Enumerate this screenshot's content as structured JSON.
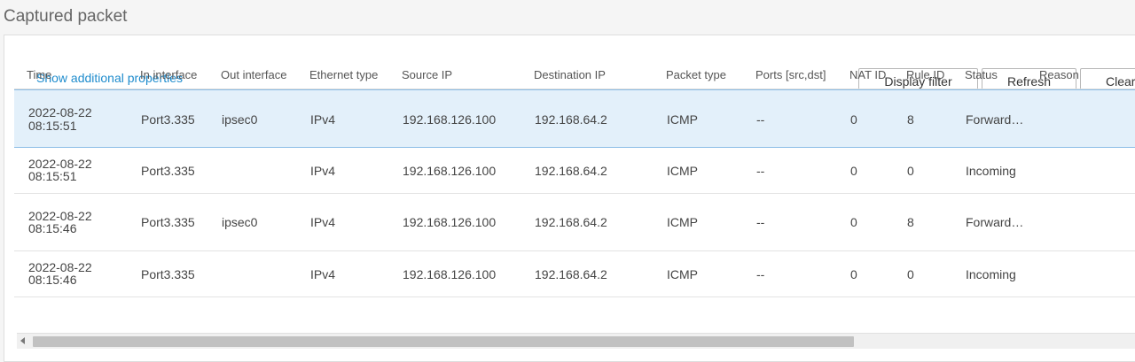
{
  "page": {
    "title": "Captured packet"
  },
  "toolbar": {
    "show_props": "Show additional properties",
    "display_filter": "Display filter",
    "refresh": "Refresh",
    "clear": "Clear"
  },
  "table": {
    "columns": [
      "Time",
      "In interface",
      "Out interface",
      "Ethernet type",
      "Source IP",
      "Destination IP",
      "Packet type",
      "Ports [src,dst]",
      "NAT ID",
      "Rule ID",
      "Status",
      "Reason"
    ],
    "rows": [
      {
        "date": "2022-08-22",
        "time": "08:15:51",
        "in": "Port3.335",
        "out": "ipsec0",
        "eth": "IPv4",
        "src": "192.168.126.100",
        "dst": "192.168.64.2",
        "ptype": "ICMP",
        "ports": "--",
        "nat": "0",
        "rule": "8",
        "status": "Forward…",
        "reason": ""
      },
      {
        "date": "2022-08-22",
        "time": "08:15:51",
        "in": "Port3.335",
        "out": "",
        "eth": "IPv4",
        "src": "192.168.126.100",
        "dst": "192.168.64.2",
        "ptype": "ICMP",
        "ports": "--",
        "nat": "0",
        "rule": "0",
        "status": "Incoming",
        "reason": ""
      },
      {
        "date": "2022-08-22",
        "time": "08:15:46",
        "in": "Port3.335",
        "out": "ipsec0",
        "eth": "IPv4",
        "src": "192.168.126.100",
        "dst": "192.168.64.2",
        "ptype": "ICMP",
        "ports": "--",
        "nat": "0",
        "rule": "8",
        "status": "Forward…",
        "reason": ""
      },
      {
        "date": "2022-08-22",
        "time": "08:15:46",
        "in": "Port3.335",
        "out": "",
        "eth": "IPv4",
        "src": "192.168.126.100",
        "dst": "192.168.64.2",
        "ptype": "ICMP",
        "ports": "--",
        "nat": "0",
        "rule": "0",
        "status": "Incoming",
        "reason": ""
      }
    ]
  },
  "colors": {
    "accent": "#1f8ccd",
    "selected_row": "#e3f0fa",
    "selected_border": "#8cbde6"
  }
}
